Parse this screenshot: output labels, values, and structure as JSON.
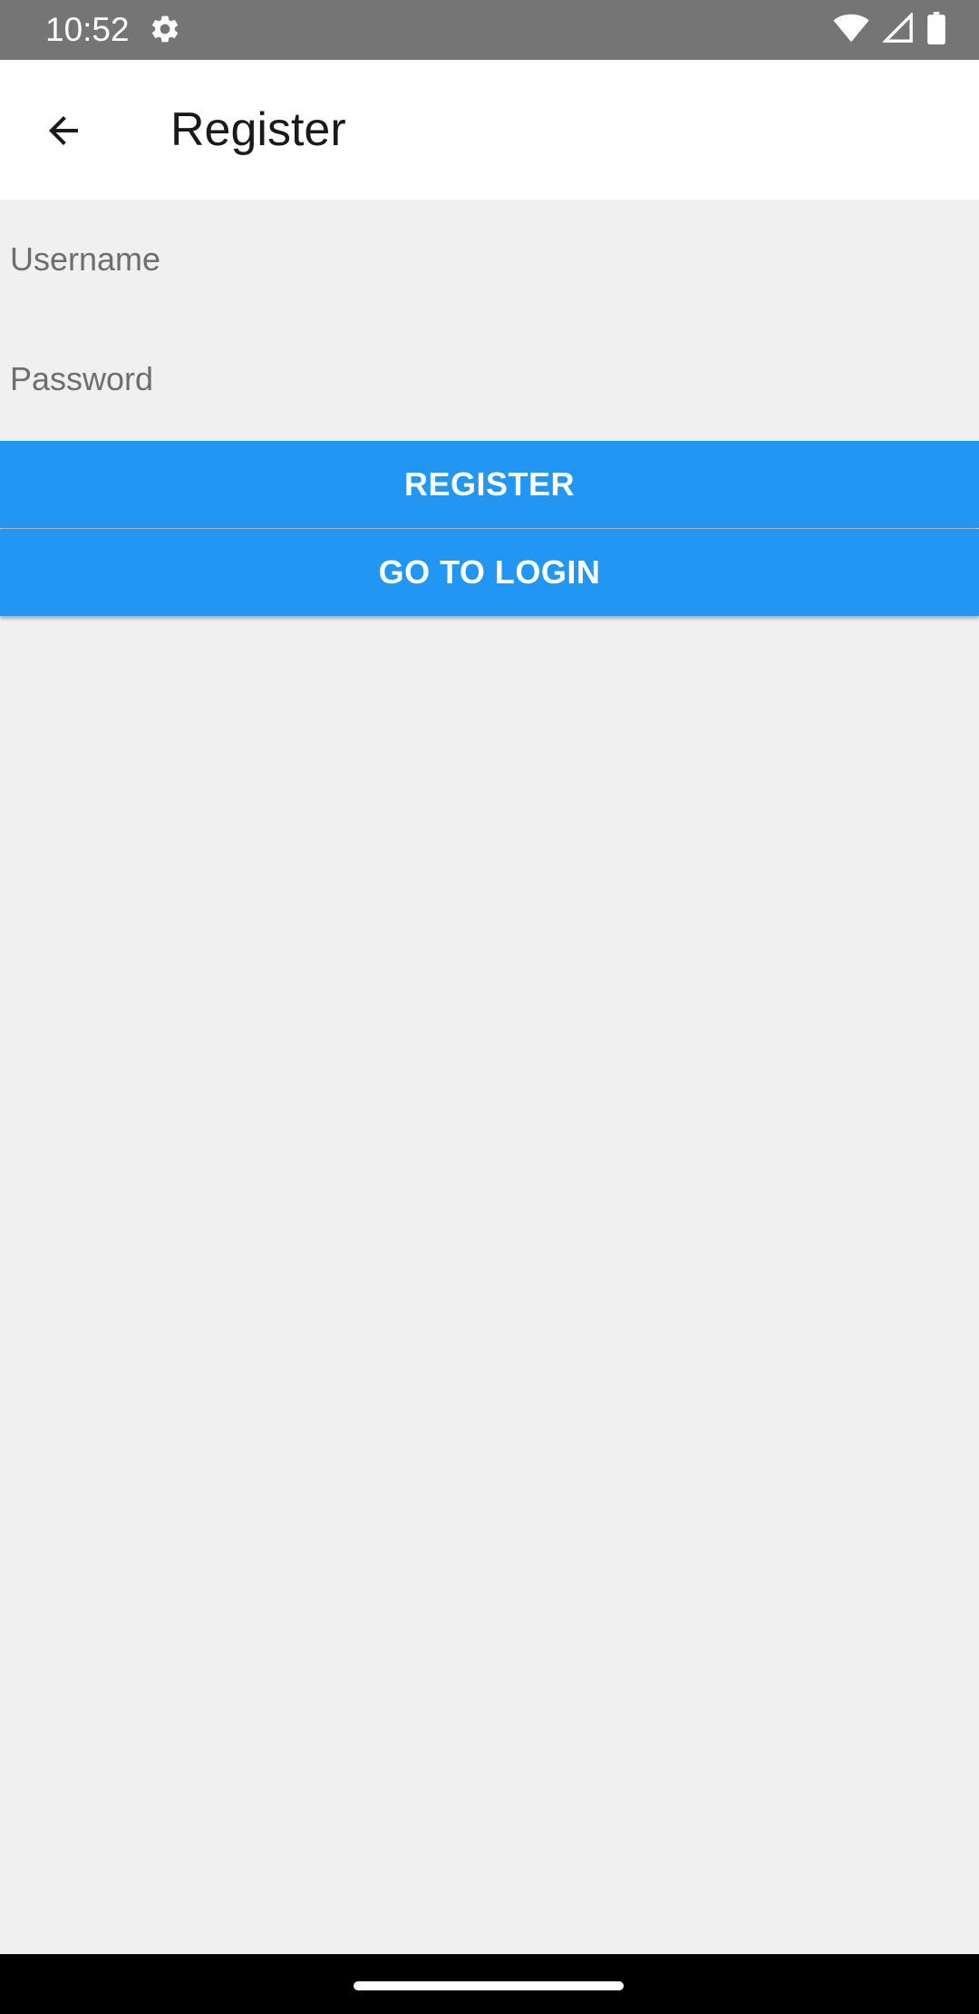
{
  "status_bar": {
    "time": "10:52",
    "icons": [
      "settings-icon",
      "wifi-icon",
      "signal-icon",
      "battery-icon"
    ]
  },
  "app_bar": {
    "title": "Register",
    "back_icon": "arrow-back-icon"
  },
  "form": {
    "username_placeholder": "Username",
    "username_value": "",
    "password_placeholder": "Password",
    "password_value": ""
  },
  "buttons": {
    "register_label": "REGISTER",
    "go_to_login_label": "GO TO LOGIN"
  },
  "colors": {
    "status_bar": "#757575",
    "app_bar": "#ffffff",
    "background": "#f0f0f0",
    "button": "#2196f3",
    "button_text": "#ffffff",
    "nav_bar": "#000000"
  }
}
